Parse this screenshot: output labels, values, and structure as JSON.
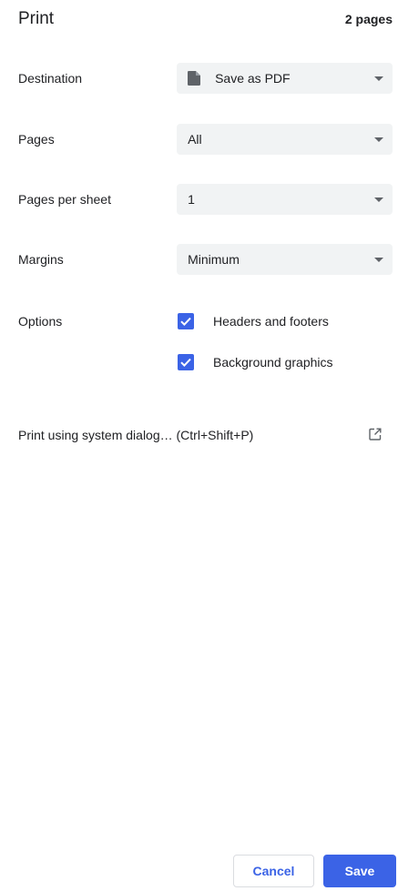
{
  "header": {
    "title": "Print",
    "page_count": "2 pages"
  },
  "destination": {
    "label": "Destination",
    "value": "Save as PDF",
    "icon": "file-icon"
  },
  "pages": {
    "label": "Pages",
    "value": "All"
  },
  "pages_per_sheet": {
    "label": "Pages per sheet",
    "value": "1"
  },
  "margins": {
    "label": "Margins",
    "value": "Minimum"
  },
  "options": {
    "label": "Options",
    "items": [
      {
        "label": "Headers and footers",
        "checked": true
      },
      {
        "label": "Background graphics",
        "checked": true
      }
    ]
  },
  "system_dialog": {
    "label": "Print using system dialog… (Ctrl+Shift+P)",
    "icon": "open-in-new-icon"
  },
  "footer": {
    "cancel_label": "Cancel",
    "save_label": "Save"
  },
  "colors": {
    "accent": "#3b63e6",
    "select_bg": "#f1f3f4",
    "text": "#202124"
  }
}
